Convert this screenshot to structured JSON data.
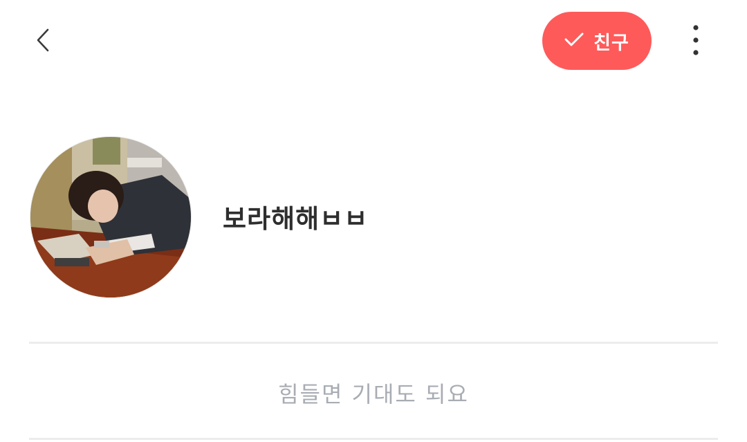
{
  "header": {
    "back_icon": "chevron-left-icon",
    "friend_button": {
      "icon": "check-icon",
      "label": "친구",
      "color": "#fe5a5a"
    },
    "more_icon": "more-vertical-icon"
  },
  "profile": {
    "avatar": "profile-photo",
    "name": "보라해해ㅂㅂ",
    "status_message": "힘들면 기대도 되요"
  }
}
